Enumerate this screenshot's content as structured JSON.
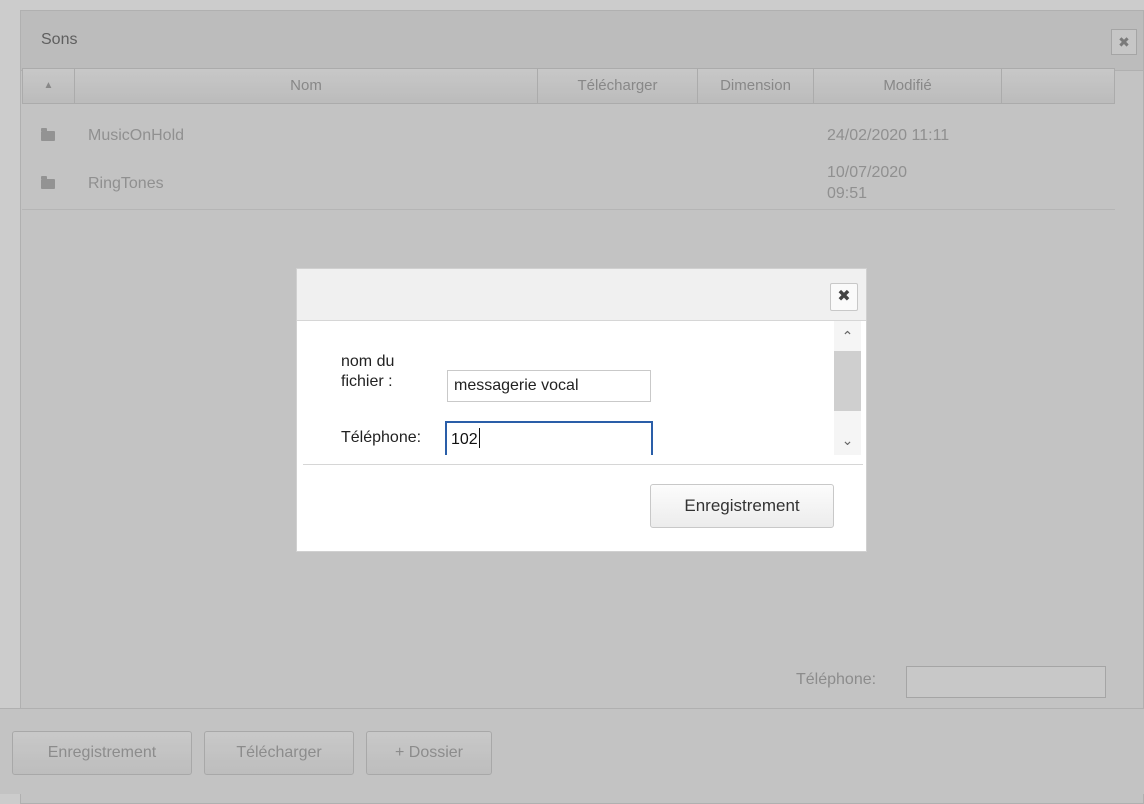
{
  "window": {
    "title": "Sons",
    "close_glyph": "✖"
  },
  "grid": {
    "sort_glyph": "▲",
    "columns": [
      "Nom",
      "Télécharger",
      "Dimension",
      "Modifié"
    ],
    "rows": [
      {
        "icon": "folder-icon",
        "name": "MusicOnHold",
        "modified": "24/02/2020 11:11"
      },
      {
        "icon": "folder-icon",
        "name": "RingTones",
        "modified": "10/07/2020 09:51"
      }
    ]
  },
  "phone_filter": {
    "label": "Téléphone:",
    "value": ""
  },
  "footer": {
    "buttons": [
      "Enregistrement",
      "Télécharger",
      "+ Dossier"
    ]
  },
  "dialog": {
    "close_glyph": "✖",
    "filename_label": "nom du fichier :",
    "filename_value": "messagerie vocal",
    "phone_label": "Téléphone:",
    "phone_value": "102",
    "submit_label": "Enregistrement",
    "scroll_up_glyph": "⌃",
    "scroll_down_glyph": "⌄"
  },
  "colors": {
    "overlay": "rgba(0,0,0,0.20)",
    "focus_border": "#2a5ea8"
  }
}
